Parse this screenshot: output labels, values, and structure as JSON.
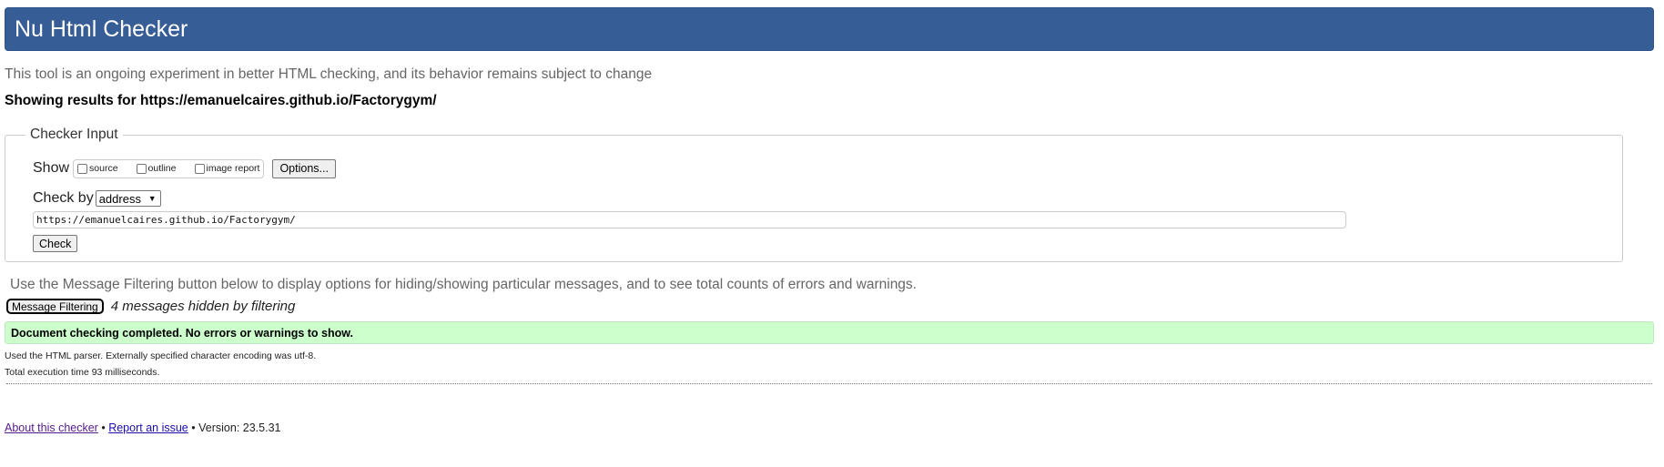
{
  "header": {
    "title": "Nu Html Checker"
  },
  "intro": "This tool is an ongoing experiment in better HTML checking, and its behavior remains subject to change",
  "results_for": "Showing results for https://emanuelcaires.github.io/Factorygym/",
  "checker_input": {
    "legend": "Checker Input",
    "show_label": "Show",
    "options": [
      {
        "label": "source",
        "checked": false
      },
      {
        "label": "outline",
        "checked": false
      },
      {
        "label": "image report",
        "checked": false
      }
    ],
    "options_button": "Options...",
    "check_by_label": "Check by",
    "check_by_value": "address",
    "url_value": "https://emanuelcaires.github.io/Factorygym/",
    "check_button": "Check"
  },
  "filtering": {
    "intro": "Use the Message Filtering button below to display options for hiding/showing particular messages, and to see total counts of errors and warnings.",
    "button": "Message Filtering",
    "hidden_note": "4 messages hidden by filtering"
  },
  "result": {
    "success_message": "Document checking completed. No errors or warnings to show.",
    "parser_info": "Used the HTML parser. Externally specified character encoding was utf-8.",
    "execution_time": "Total execution time 93 milliseconds."
  },
  "footer": {
    "about_link": "About this checker",
    "separator": "•",
    "report_link": "Report an issue",
    "version": "Version: 23.5.31"
  },
  "colors": {
    "header_bg": "#365d95",
    "success_bg": "#ccffcc",
    "muted_text": "#666666"
  }
}
